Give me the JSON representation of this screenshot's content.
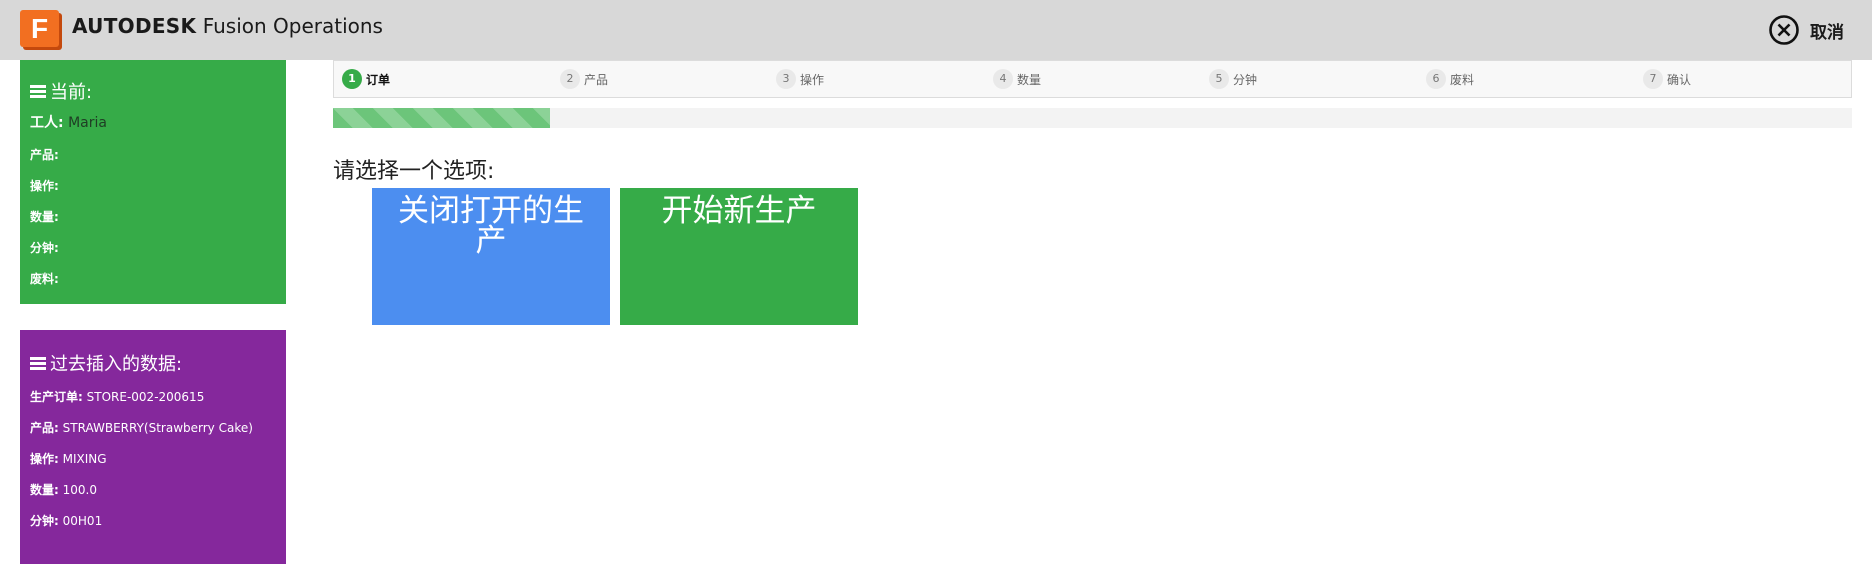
{
  "header": {
    "brand_bold": "AUTODESK",
    "brand_rest": "Fusion Operations",
    "logo_letter": "F",
    "cancel_label": "取消"
  },
  "current_panel": {
    "title": "当前:",
    "worker_label": "工人:",
    "worker_value": "Maria",
    "fields": [
      {
        "label": "产品:",
        "value": ""
      },
      {
        "label": "操作:",
        "value": ""
      },
      {
        "label": "数量:",
        "value": ""
      },
      {
        "label": "分钟:",
        "value": ""
      },
      {
        "label": "废料:",
        "value": ""
      }
    ]
  },
  "past_panel": {
    "title": "过去插入的数据:",
    "fields": [
      {
        "label": "生产订单:",
        "value": "STORE-002-200615"
      },
      {
        "label": "产品:",
        "value": "STRAWBERRY(Strawberry Cake)"
      },
      {
        "label": "操作:",
        "value": "MIXING"
      },
      {
        "label": "数量:",
        "value": "100.0"
      },
      {
        "label": "分钟:",
        "value": "00H01"
      }
    ]
  },
  "steps": [
    {
      "num": "1",
      "label": "订单",
      "active": true
    },
    {
      "num": "2",
      "label": "产品",
      "active": false
    },
    {
      "num": "3",
      "label": "操作",
      "active": false
    },
    {
      "num": "4",
      "label": "数量",
      "active": false
    },
    {
      "num": "5",
      "label": "分钟",
      "active": false
    },
    {
      "num": "6",
      "label": "废料",
      "active": false
    },
    {
      "num": "7",
      "label": "确认",
      "active": false
    }
  ],
  "progress": {
    "fraction": 0.143
  },
  "main": {
    "prompt": "请选择一个选项:",
    "option_close": "关闭打开的生产",
    "option_new": "开始新生产"
  },
  "colors": {
    "current_panel": "#36ab48",
    "past_panel": "#85289c",
    "close_tile": "#4c8ef0",
    "new_tile": "#36ab48",
    "progress_fill": "#6cc57a",
    "logo": "#f26f21"
  }
}
